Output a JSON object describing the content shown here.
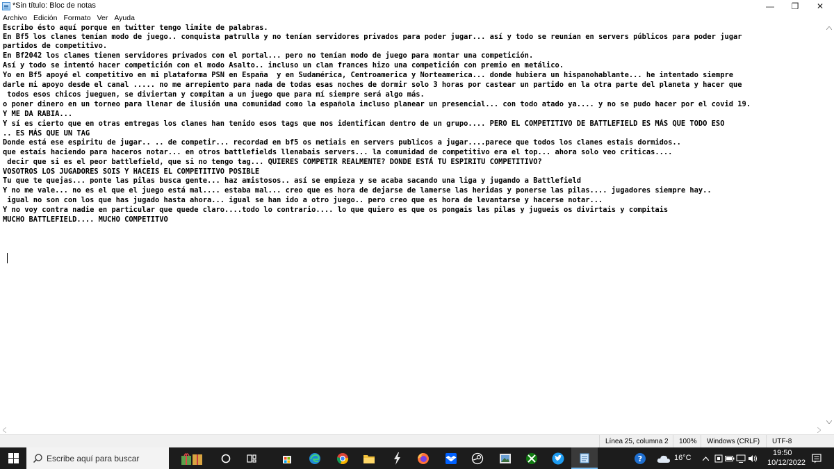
{
  "window": {
    "title": "*Sin título: Bloc de notas",
    "controls": {
      "minimize": "—",
      "maximize": "❐",
      "close": "✕"
    }
  },
  "menu": [
    "Archivo",
    "Edición",
    "Formato",
    "Ver",
    "Ayuda"
  ],
  "editor": {
    "lines": [
      "Escribo ésto aquí porque en twitter tengo limite de palabras.",
      "En Bf5 los clanes tenían modo de juego.. conquista patrulla y no tenían servidores privados para poder jugar... así y todo se reunían en servers públicos para poder jugar",
      "partidos de competitivo.",
      "En Bf2042 los clanes tienen servidores privados con el portal... pero no tenían modo de juego para montar una competición.",
      "Así y todo se intentó hacer competición con el modo Asalto.. incluso un clan frances hizo una competición con premio en metálico.",
      "Yo en Bf5 apoyé el competitivo en mi plataforma PSN en España  y en Sudamérica, Centroamerica y Norteamerica... donde hubiera un hispanohablante... he intentado siempre",
      "darle mi apoyo desde el canal ..... no me arrepiento para nada de todas esas noches de dormir solo 3 horas por castear un partido en la otra parte del planeta y hacer que",
      " todos esos chicos jueguen, se diviertan y compitan a un juego que para mí siempre será algo más.",
      "o poner dinero en un torneo para llenar de ilusión una comunidad como la española incluso planear un presencial... con todo atado ya.... y no se pudo hacer por el covid 19.",
      "Y ME DA RABIA...",
      "Y sí es cierto que en otras entregas los clanes han tenido esos tags que nos identifican dentro de un grupo.... PERO EL COMPETITIVO DE BATTLEFIELD ES MÁS QUE TODO ESO",
      ".. ES MÁS QUE UN TAG",
      "Donde está ese espiritu de jugar.. .. de competir... recordad en bf5 os metiais en servers publicos a jugar....parece que todos los clanes estais dormidos..",
      "que estaís haciendo para haceros notar... en otros battlefields llenabais servers... la comunidad de competitivo era el top... ahora solo veo criticas....",
      " decir que si es el peor battlefield, que si no tengo tag... QUIERES COMPETIR REALMENTE? DONDE ESTÁ TU ESPIRITU COMPETITIVO?",
      "VOSOTROS LOS JUGADORES SOIS Y HACEIS EL COMPETITIVO POSIBLE",
      "Tu que te quejas... ponte las pilas busca gente... haz amistosos.. así se empieza y se acaba sacando una liga y jugando a Battlefield",
      "Y no me vale... no es el que el juego está mal.... estaba mal... creo que es hora de dejarse de lamerse las heridas y ponerse las pilas.... jugadores siempre hay..",
      " igual no son con los que has jugado hasta ahora... igual se han ido a otro juego.. pero creo que es hora de levantarse y hacerse notar...",
      "Y no voy contra nadie en particular que quede claro....todo lo contrario.... lo que quiero es que os pongais las pilas y jugueis os divirtais y compitais",
      "MUCHO BATTLEFIELD.... MUCHO COMPETITVO"
    ]
  },
  "status": {
    "position": "Línea 25, columna 2",
    "zoom": "100%",
    "line_ending": "Windows (CRLF)",
    "encoding": "UTF-8"
  },
  "taskbar": {
    "search_placeholder": "Escribe aquí para buscar",
    "weather": "16°C",
    "time": "19:50",
    "date": "10/12/2022"
  }
}
